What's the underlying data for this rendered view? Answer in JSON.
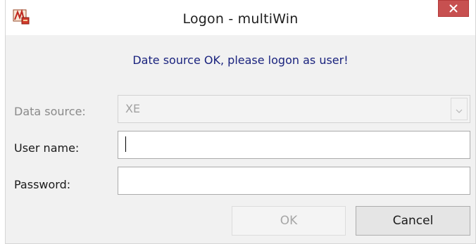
{
  "window": {
    "title": "Logon - multiWin",
    "app_icon": "multiwin-app-icon",
    "close_icon": "close-icon"
  },
  "message": "Date source OK, please logon as user!",
  "form": {
    "data_source": {
      "label": "Data source:",
      "value": "XE",
      "icon": "chevron-down-icon",
      "enabled": false
    },
    "user_name": {
      "label": "User name:",
      "value": "",
      "focused": true
    },
    "password": {
      "label": "Password:",
      "value": ""
    }
  },
  "buttons": {
    "ok": {
      "label": "OK",
      "enabled": false
    },
    "cancel": {
      "label": "Cancel",
      "enabled": true
    }
  },
  "colors": {
    "message": "#1a237e",
    "close_button": "#c75050"
  }
}
